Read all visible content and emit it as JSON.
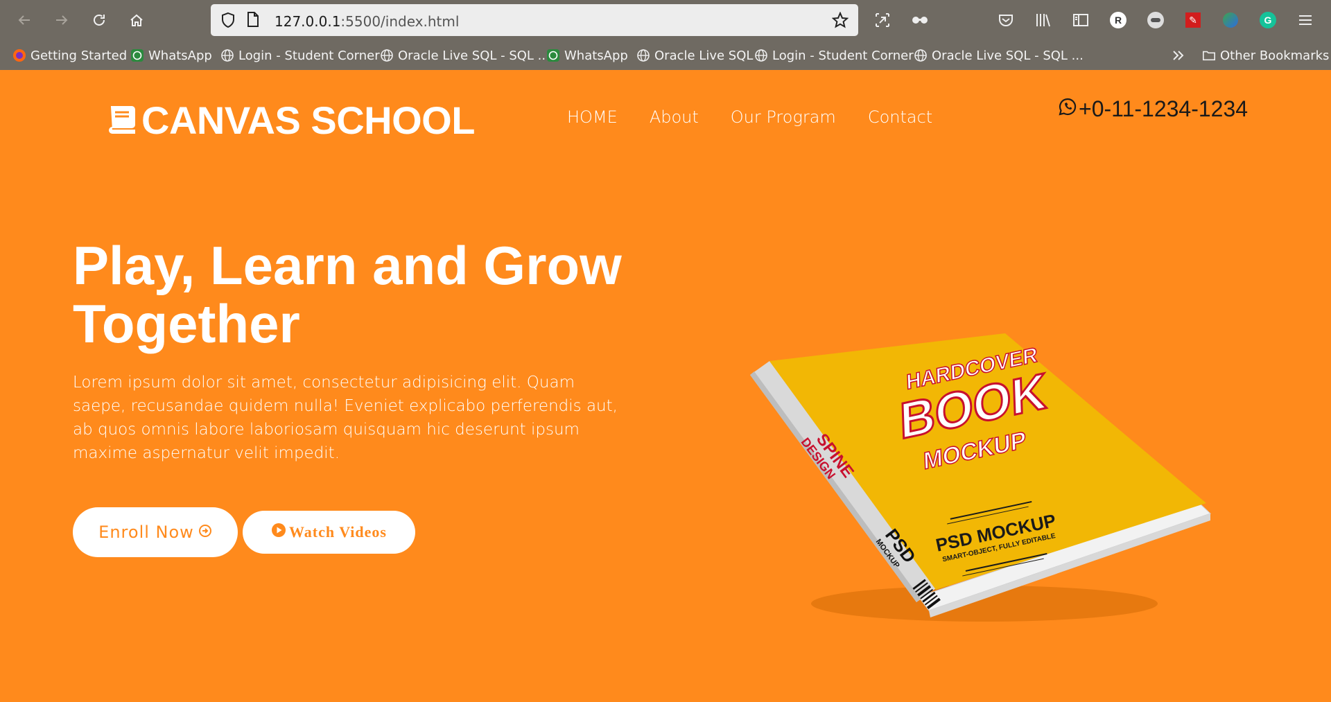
{
  "browser": {
    "url_host": "127.0.0.1",
    "url_path": ":5500/index.html",
    "bookmarks": [
      {
        "label": "Getting Started",
        "icon": "firefox-icon"
      },
      {
        "label": "WhatsApp",
        "icon": "whatsapp-icon"
      },
      {
        "label": "Login - Student Corner",
        "icon": "globe-icon"
      },
      {
        "label": "Oracle Live SQL - SQL ...",
        "icon": "globe-icon"
      },
      {
        "label": "WhatsApp",
        "icon": "whatsapp-icon"
      },
      {
        "label": "Oracle Live SQL",
        "icon": "globe-icon"
      },
      {
        "label": "Login - Student Corner",
        "icon": "globe-icon"
      },
      {
        "label": "Oracle Live SQL - SQL ...",
        "icon": "globe-icon"
      }
    ],
    "other_bookmarks": "Other Bookmarks",
    "profile_letter": "R"
  },
  "site": {
    "logo_text": "CANVAS SCHOOL",
    "nav": [
      "HOME",
      "About",
      "Our Program",
      "Contact"
    ],
    "phone": "+0-11-1234-1234"
  },
  "hero": {
    "title_line1": "Play, Learn and Grow",
    "title_line2": "Together",
    "text": "Lorem ipsum dolor sit amet, consectetur adipisicing elit. Quam saepe, recusandae quidem nulla! Eveniet explicabo perferendis aut, ab quos omnis labore laboriosam quisquam hic deserunt ipsum maxime aspernatur velit impedit.",
    "enroll_label": "Enroll Now",
    "watch_label": "Watch Videos"
  },
  "book": {
    "cover_line1": "HARDCOVER",
    "cover_line2": "BOOK",
    "cover_line3": "MOCKUP",
    "psd_title": "PSD MOCKUP",
    "psd_sub": "SMART-OBJECT, FULLY EDITABLE",
    "spine_line1": "SPINE",
    "spine_line2": "DESIGN",
    "spine_psd": "PSD",
    "spine_mockup": "MOCKUP"
  },
  "colors": {
    "page_bg": "#ff8a1c",
    "chrome_bg": "#6f6a62",
    "cover": "#f2b705",
    "cover_text_red": "#c8102e"
  }
}
